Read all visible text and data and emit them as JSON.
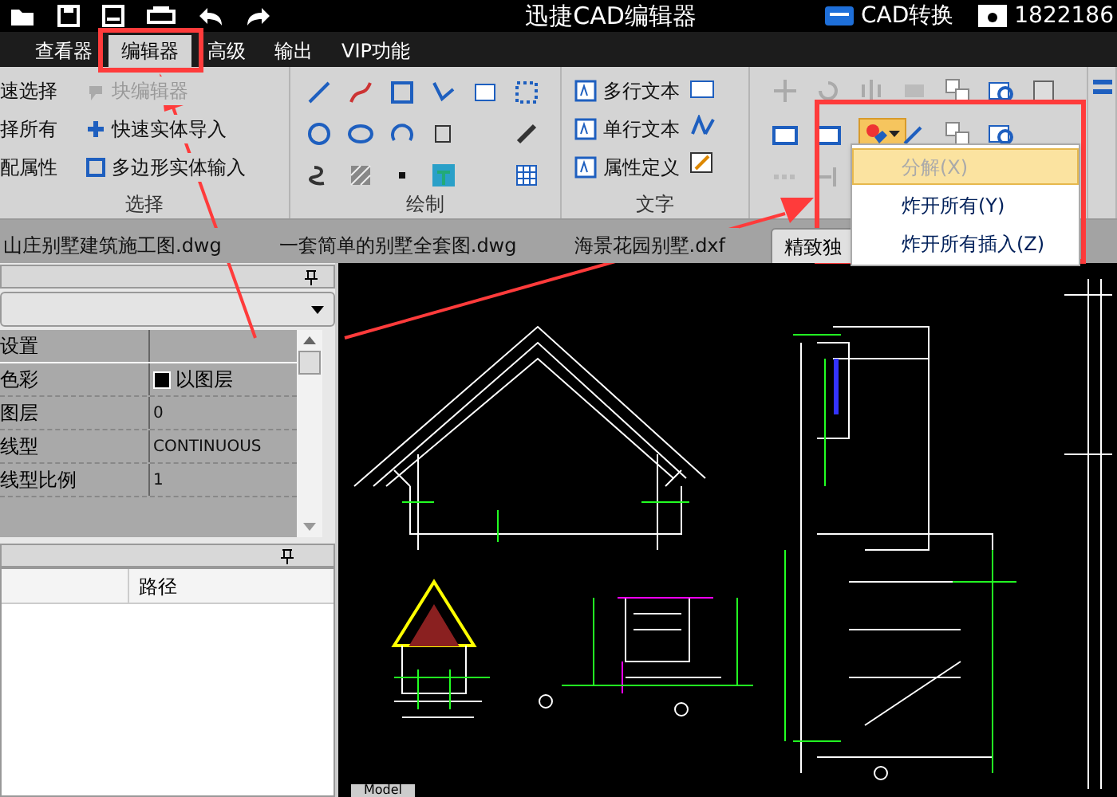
{
  "title_bar": {
    "title": "迅捷CAD编辑器",
    "convert_label": "CAD转换",
    "account": "1822186"
  },
  "menu_tabs": [
    {
      "label": "查看器",
      "selected": false
    },
    {
      "label": "编辑器",
      "selected": true
    },
    {
      "label": "高级",
      "selected": false
    },
    {
      "label": "输出",
      "selected": false
    },
    {
      "label": "VIP功能",
      "selected": false
    }
  ],
  "ribbon": {
    "select_group": {
      "label": "选择",
      "commands": [
        {
          "label": "速选择",
          "disabled": false
        },
        {
          "label": "择所有",
          "disabled": false
        },
        {
          "label": "配属性",
          "disabled": false
        }
      ],
      "block_commands": [
        {
          "label": "块编辑器",
          "disabled": true
        },
        {
          "label": "快速实体导入",
          "disabled": false
        },
        {
          "label": "多边形实体输入",
          "disabled": false
        }
      ]
    },
    "draw_group": {
      "label": "绘制"
    },
    "text_group": {
      "label": "文字",
      "commands": [
        {
          "label": "多行文本"
        },
        {
          "label": "单行文本"
        },
        {
          "label": "属性定义"
        }
      ]
    }
  },
  "explode_menu": [
    {
      "label": "分解(X)",
      "disabled": true,
      "highlighted": true
    },
    {
      "label": "炸开所有(Y)",
      "disabled": false,
      "highlighted": false
    },
    {
      "label": "炸开所有插入(Z)",
      "disabled": false,
      "highlighted": false
    }
  ],
  "doc_tabs": [
    {
      "label": "山庄别墅建筑施工图.dwg",
      "selected": false
    },
    {
      "label": "一套简单的别墅全套图.dwg",
      "selected": false
    },
    {
      "label": "海景花园别墅.dxf",
      "selected": false
    },
    {
      "label": "精致独",
      "selected": true
    }
  ],
  "properties": {
    "rows": [
      {
        "name": "设置",
        "kind": "section"
      },
      {
        "name": "色彩",
        "value": "以图层",
        "kind": "color"
      },
      {
        "name": "图层",
        "value": "0",
        "kind": "text"
      },
      {
        "name": "线型",
        "value": "CONTINUOUS",
        "kind": "text"
      },
      {
        "name": "线型比例",
        "value": "1",
        "kind": "text"
      }
    ]
  },
  "files_panel": {
    "columns": [
      "路径"
    ]
  },
  "layout_tab": "Model"
}
